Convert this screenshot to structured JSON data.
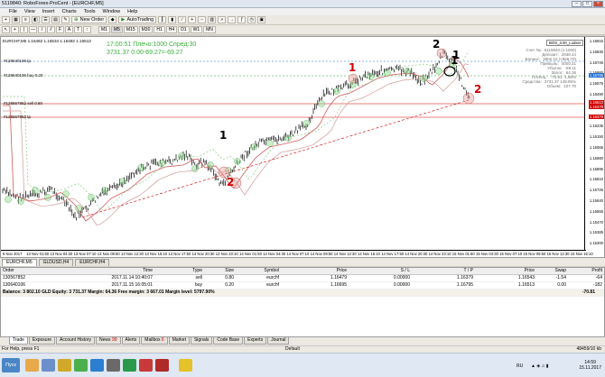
{
  "window": {
    "title": "5119840: RoboForex-ProCent - [EURCHF,M5]"
  },
  "menu": [
    "File",
    "View",
    "Insert",
    "Charts",
    "Tools",
    "Window",
    "Help"
  ],
  "toolbar": {
    "new_order": "New Order",
    "autotrading": "AutoTrading"
  },
  "timeframes": [
    "M1",
    "M5",
    "M15",
    "M30",
    "H1",
    "H4",
    "D1",
    "W1",
    "MN"
  ],
  "active_timeframe": "M5",
  "chart": {
    "header": "EURCHF,M5  1.16492 1.16534 1.16492 1.16513",
    "overlay_line1": "17:00:51 Плечо:1000 Спред:30",
    "overlay_line2": "3731.37   0.00-69.27=-69.27",
    "order_labels": [
      {
        "text": "#128640106 tp"
      },
      {
        "text": "#128640106 buy 0.20"
      },
      {
        "text": "#128567852 sell 0.80"
      },
      {
        "text": "#128567852 tp"
      }
    ],
    "bos_box": "BOS_3.00_Lodser",
    "info_panel": [
      {
        "k": "Счет №",
        "v": "5119840 (1:1000)"
      },
      {
        "k": "Депозит",
        "v": "2938.44"
      },
      {
        "k": "Баланс",
        "v": "3802.10 (+866.70)"
      },
      {
        "k": "Прибыль",
        "v": "4000.21"
      },
      {
        "k": "Убыток",
        "v": "-98.11"
      },
      {
        "k": "Залог",
        "v": "64.36"
      },
      {
        "k": "Потенц.",
        "v": "-70.81  -1.86%"
      },
      {
        "k": "Средства",
        "v": "3731.37  148.85%"
      },
      {
        "k": "Объем",
        "v": "107.70"
      }
    ],
    "price_labels": [
      "1.16915",
      "1.16830",
      "1.16745",
      "1.16660",
      "1.16575",
      "1.16490",
      "1.16405",
      "1.16320",
      "1.16235",
      "1.16150",
      "1.16065",
      "1.15980",
      "1.15895",
      "1.15810",
      "1.15725",
      "1.15640",
      "1.15555",
      "1.15470",
      "1.15385",
      "1.15300"
    ],
    "highlight_prices": [
      {
        "text": "1.16795",
        "color": "#1e6fd6"
      },
      {
        "text": "1.16513",
        "color": "#d40000"
      },
      {
        "text": "1.16479",
        "color": "#d40000"
      },
      {
        "text": "1.16379",
        "color": "#d40000"
      }
    ],
    "time_labels": [
      "9 Nov 2017",
      "13 Nov 01:50",
      "13 Nov 04:30",
      "13 Nov 07:10",
      "13 Nov 09:50",
      "13 Nov 12:30",
      "13 Nov 15:10",
      "13 Nov 17:50",
      "13 Nov 20:30",
      "13 Nov 23:10",
      "14 Nov 01:50",
      "14 Nov 04:30",
      "14 Nov 07:10",
      "14 Nov 09:50",
      "14 Nov 12:30",
      "14 Nov 15:10",
      "14 Nov 17:50",
      "14 Nov 20:30",
      "14 Nov 23:10",
      "15 Nov 01:50",
      "15 Nov 04:30",
      "15 Nov 07:10",
      "15 Nov 09:50",
      "15 Nov 12:30",
      "15 Nov 15:10"
    ],
    "annotations": [
      "1",
      "2",
      "1",
      "2",
      "1",
      "1",
      "2"
    ]
  },
  "chart_tabs": [
    "EURCHF,M5",
    "GLDUSD,H4",
    "EURCHF,H4"
  ],
  "active_chart_tab": "EURCHF,M5",
  "terminal": {
    "columns": [
      "Order",
      "Time",
      "Type",
      "Size",
      "Symbol",
      "Price",
      "S / L",
      "T / P",
      "Price",
      "Swap",
      "Profit"
    ],
    "rows": [
      [
        "130567852",
        "2017.11.14 10:40:07",
        "sell",
        "0.80",
        "eurchf",
        "1.16479",
        "0.00000",
        "1.16379",
        "1.16543",
        "-1.54",
        "-64"
      ],
      [
        "130640106",
        "2017.11.15 16:05:01",
        "buy",
        "0.20",
        "eurchf",
        "1.16695",
        "0.00000",
        "1.16795",
        "1.16513",
        "0.00",
        "-182"
      ]
    ],
    "balance_line": "Balance: 3 802.10 GLD  Equity: 3 731.37  Margin: 64.36  Free margin: 3 667.01  Margin level: 5797.90%",
    "balance_profit": "-70.81"
  },
  "bottom_tabs": [
    "Trade",
    "Exposure",
    "Account History",
    "News",
    "Alerts",
    "Mailbox",
    "Market",
    "Signals",
    "Code Base",
    "Experts",
    "Journal"
  ],
  "bottom_tab_badges": {
    "News": "99",
    "Mailbox": "6"
  },
  "active_bottom_tab": "Trade",
  "status": {
    "help": "For Help, press F1",
    "profile": "Default",
    "traffic": "48459/10 kb"
  },
  "taskbar": {
    "start": "Пуск",
    "lang": "RU",
    "time": "14:59",
    "date": "15.11.2017"
  }
}
